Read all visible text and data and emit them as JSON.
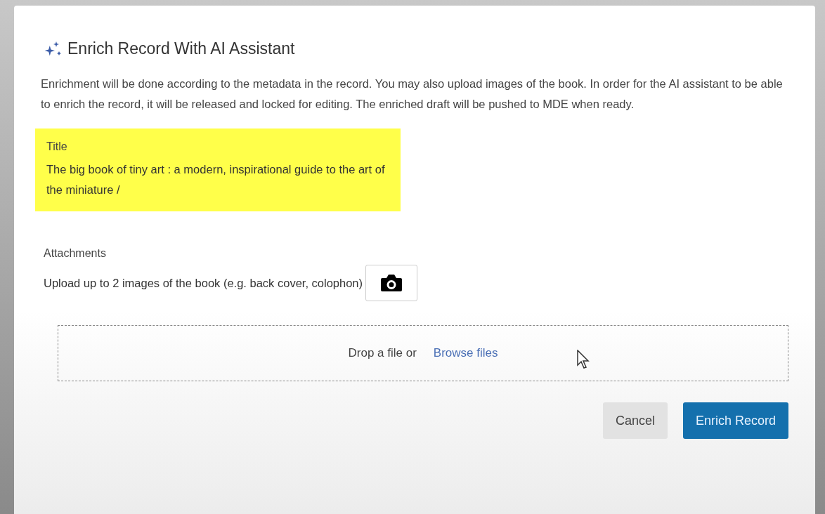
{
  "dialog": {
    "title": "Enrich Record With AI Assistant",
    "description": "Enrichment will be done according to the metadata in the record. You may also upload images of the book. In order for the AI assistant to be able to enrich the record, it will be released and locked for editing. The enriched draft will be pushed to MDE when ready.",
    "title_field": {
      "label": "Title",
      "value": "The big book of tiny art : a modern, inspirational guide to the art of the miniature /",
      "highlighted": true
    },
    "attachments": {
      "label": "Attachments",
      "hint": "Upload up to 2 images of the book (e.g. back cover, colophon)"
    },
    "dropzone": {
      "text": "Drop a file or",
      "link": "Browse files"
    },
    "buttons": [
      {
        "label": "Cancel",
        "kind": "secondary"
      },
      {
        "label": "Enrich Record",
        "kind": "primary"
      }
    ]
  }
}
